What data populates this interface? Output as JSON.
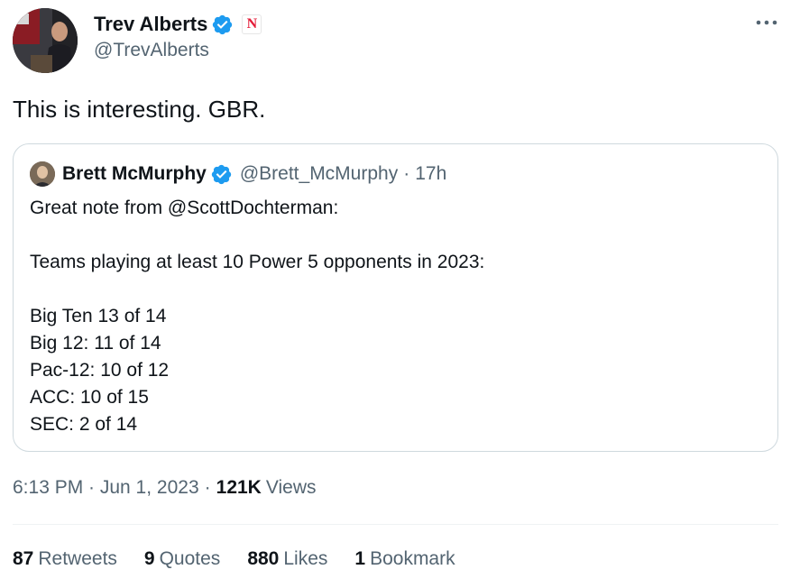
{
  "tweet": {
    "author": {
      "name": "Trev Alberts",
      "handle": "@TrevAlberts",
      "affiliation_badge_letter": "N"
    },
    "text": "This is interesting. GBR.",
    "more_icon": "more-horizontal-icon",
    "timestamp": "6:13 PM · Jun 1, 2023",
    "views_count": "121K",
    "views_label": "Views"
  },
  "quote": {
    "author": {
      "name": "Brett McMurphy",
      "handle": "@Brett_McMurphy",
      "time": "17h"
    },
    "lines": [
      "Great note from @ScottDochterman:",
      "",
      "Teams playing at least 10 Power 5 opponents in 2023:",
      "",
      "Big Ten 13 of 14",
      "Big 12: 11 of 14",
      "Pac-12: 10 of 12",
      "ACC: 10 of 15",
      "SEC: 2 of 14"
    ]
  },
  "stats": {
    "retweets": {
      "count": "87",
      "label": "Retweets"
    },
    "quotes": {
      "count": "9",
      "label": "Quotes"
    },
    "likes": {
      "count": "880",
      "label": "Likes"
    },
    "bookmarks": {
      "count": "1",
      "label": "Bookmark"
    }
  },
  "colors": {
    "text_primary": "#0f1419",
    "text_secondary": "#536471",
    "verified_blue": "#1d9bf0",
    "border": "#cfd9de",
    "divider": "#eff3f4",
    "nebraska_red": "#e41c38"
  }
}
